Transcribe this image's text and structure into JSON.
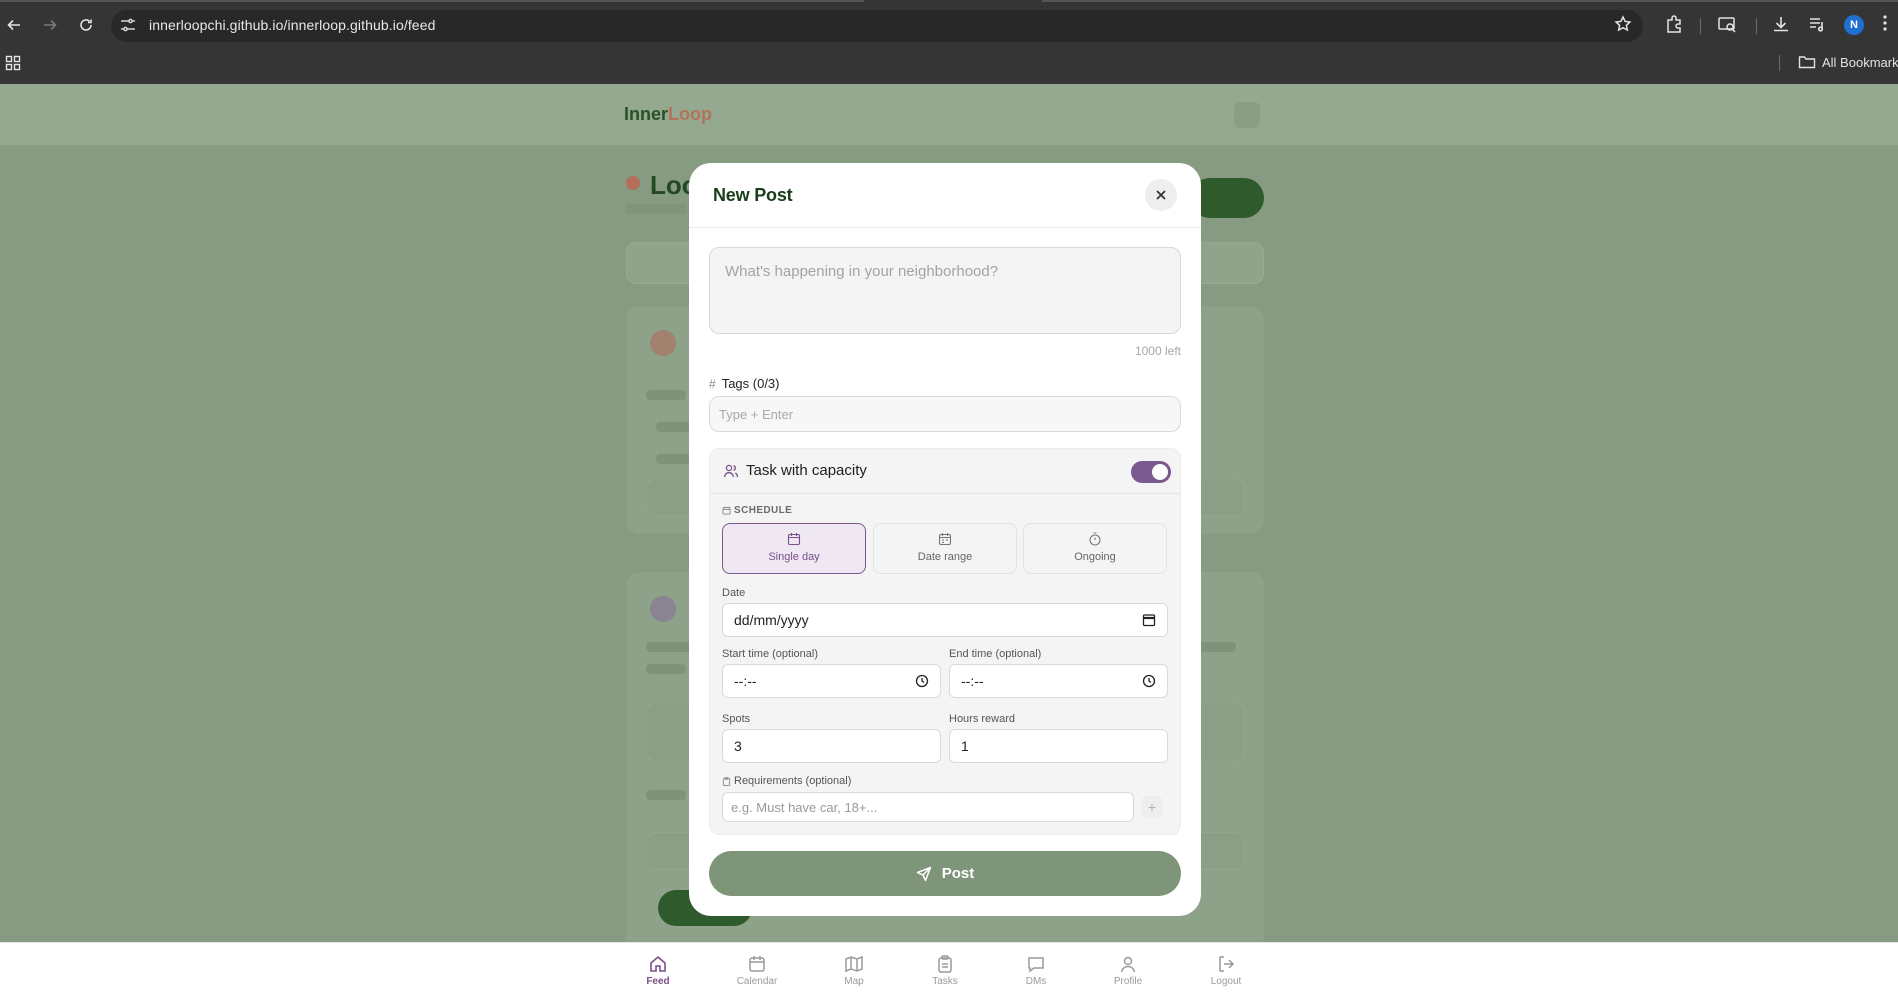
{
  "browser": {
    "url": "innerloopchi.github.io/innerloop.github.io/feed",
    "bookmarks_label": "All Bookmarks",
    "profile_initial": "N"
  },
  "app": {
    "logo_part1": "Inner",
    "logo_part2": "Loop",
    "background_title": "Loo"
  },
  "modal": {
    "title": "New Post",
    "text_placeholder": "What's happening in your neighborhood?",
    "chars_left": "1000 left",
    "tags_label": "Tags (0/3)",
    "tags_placeholder": "Type + Enter",
    "task_label": "Task with capacity",
    "task_enabled": true,
    "schedule_label": "SCHEDULE",
    "schedule_options": [
      "Single day",
      "Date range",
      "Ongoing"
    ],
    "schedule_selected": "Single day",
    "date_label": "Date",
    "date_value": "dd/mm/yyyy",
    "start_label": "Start time (optional)",
    "start_value": "--:--",
    "end_label": "End time (optional)",
    "end_value": "--:--",
    "spots_label": "Spots",
    "spots_value": "3",
    "hours_label": "Hours reward",
    "hours_value": "1",
    "requirements_label": "Requirements (optional)",
    "requirements_placeholder": "e.g. Must have car, 18+...",
    "requirements_add": "+",
    "post_button": "Post"
  },
  "bottom_nav": [
    {
      "label": "Feed",
      "icon": "home-icon",
      "active": true
    },
    {
      "label": "Calendar",
      "icon": "calendar-icon",
      "active": false
    },
    {
      "label": "Map",
      "icon": "map-icon",
      "active": false
    },
    {
      "label": "Tasks",
      "icon": "clipboard-icon",
      "active": false
    },
    {
      "label": "DMs",
      "icon": "message-icon",
      "active": false
    },
    {
      "label": "Profile",
      "icon": "user-icon",
      "active": false
    },
    {
      "label": "Logout",
      "icon": "logout-icon",
      "active": false
    }
  ],
  "colors": {
    "accent": "#7a4f8a",
    "brand_green": "#2e5a2c",
    "post_button": "#7f957a"
  }
}
